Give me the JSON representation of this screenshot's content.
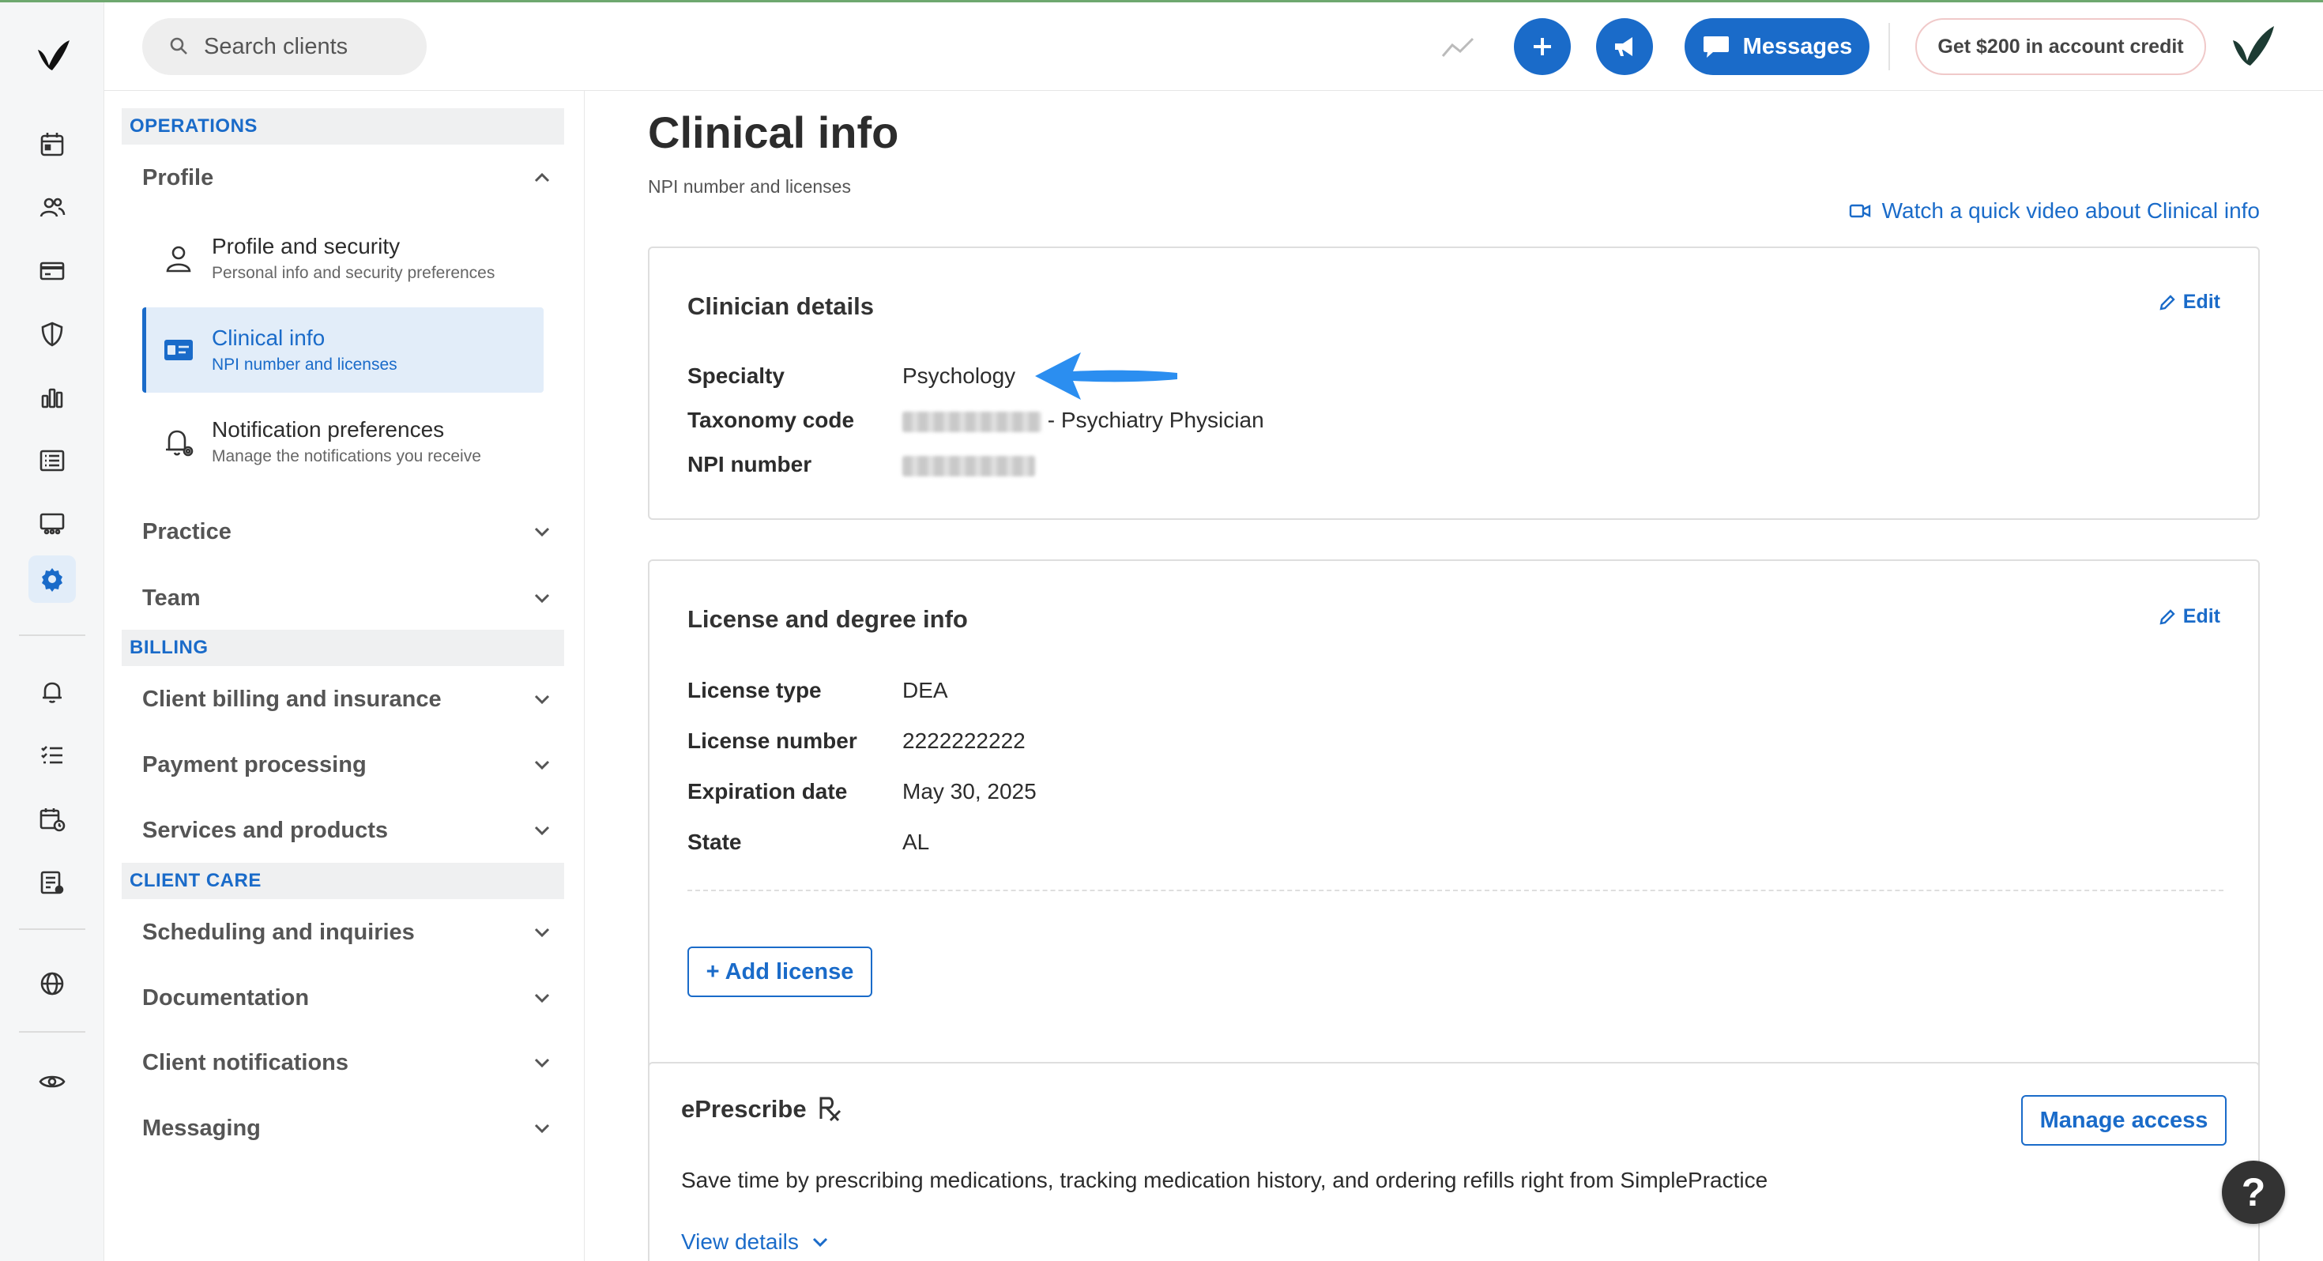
{
  "header": {
    "search_placeholder": "Search clients",
    "messages_label": "Messages",
    "credit_label": "Get $200 in account credit"
  },
  "sidebar": {
    "operations_label": "OPERATIONS",
    "profile_group": "Profile",
    "profile_items": [
      {
        "title": "Profile and security",
        "subtitle": "Personal info and security preferences"
      },
      {
        "title": "Clinical info",
        "subtitle": "NPI number and licenses"
      },
      {
        "title": "Notification preferences",
        "subtitle": "Manage the notifications you receive"
      }
    ],
    "practice_group": "Practice",
    "team_group": "Team",
    "billing_label": "BILLING",
    "billing_groups": [
      "Client billing and insurance",
      "Payment processing",
      "Services and products"
    ],
    "client_care_label": "CLIENT CARE",
    "client_care_groups": [
      "Scheduling and inquiries",
      "Documentation",
      "Client notifications",
      "Messaging"
    ]
  },
  "main": {
    "title": "Clinical info",
    "subtitle": "NPI number and licenses",
    "video_link": "Watch a quick video about Clinical info",
    "clinician": {
      "title": "Clinician details",
      "edit_label": "Edit",
      "specialty_label": "Specialty",
      "specialty_value": "Psychology",
      "taxonomy_label": "Taxonomy code",
      "taxonomy_suffix": "- Psychiatry Physician",
      "npi_label": "NPI number"
    },
    "license": {
      "title": "License and degree info",
      "edit_label": "Edit",
      "type_label": "License type",
      "type_value": "DEA",
      "number_label": "License number",
      "number_value": "2222222222",
      "expiration_label": "Expiration date",
      "expiration_value": "May 30, 2025",
      "state_label": "State",
      "state_value": "AL",
      "add_label": "+ Add license"
    },
    "eprescribe": {
      "title": "ePrescribe",
      "manage_label": "Manage access",
      "description": "Save time by prescribing medications, tracking medication history, and ordering refills right from SimplePractice",
      "view_details": "View details"
    }
  },
  "help_label": "?",
  "colors": {
    "accent": "#1a6bc9",
    "active_bg": "#e2edf9",
    "section_bg": "#eff0f1",
    "arrow": "#2b8ef0"
  }
}
